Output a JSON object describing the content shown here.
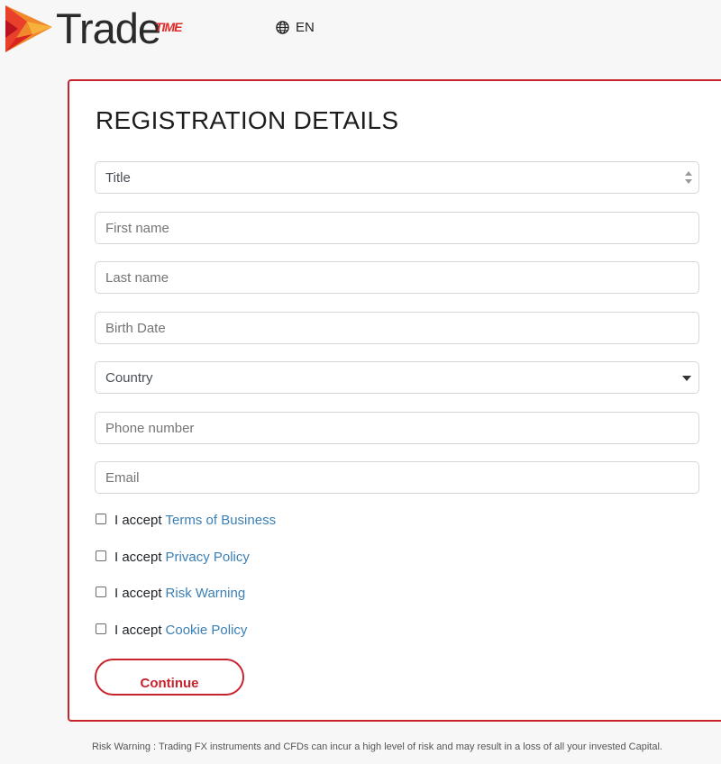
{
  "header": {
    "logo_text": "Trade",
    "logo_sup": "TIME",
    "language": "EN"
  },
  "form": {
    "title": "REGISTRATION DETAILS",
    "title_select": {
      "value": "Title"
    },
    "first_name": {
      "placeholder": "First name",
      "value": ""
    },
    "last_name": {
      "placeholder": "Last name",
      "value": ""
    },
    "birth_date": {
      "placeholder": "Birth Date",
      "value": ""
    },
    "country_select": {
      "value": "Country"
    },
    "phone": {
      "placeholder": "Phone number",
      "value": ""
    },
    "email": {
      "placeholder": "Email",
      "value": ""
    },
    "agreements": [
      {
        "prefix": "I accept",
        "link": "Terms of Business",
        "checked": false
      },
      {
        "prefix": "I accept",
        "link": "Privacy Policy",
        "checked": false
      },
      {
        "prefix": "I accept",
        "link": "Risk Warning",
        "checked": false
      },
      {
        "prefix": "I accept",
        "link": "Cookie Policy",
        "checked": false
      }
    ],
    "continue_label": "Continue"
  },
  "footer": {
    "risk_warning": "Risk Warning : Trading FX instruments and CFDs can incur a high level of risk and may result in a loss of all your invested Capital."
  },
  "colors": {
    "accent": "#c8232c",
    "link": "#3b7fb5",
    "background": "#f7f7f7"
  }
}
